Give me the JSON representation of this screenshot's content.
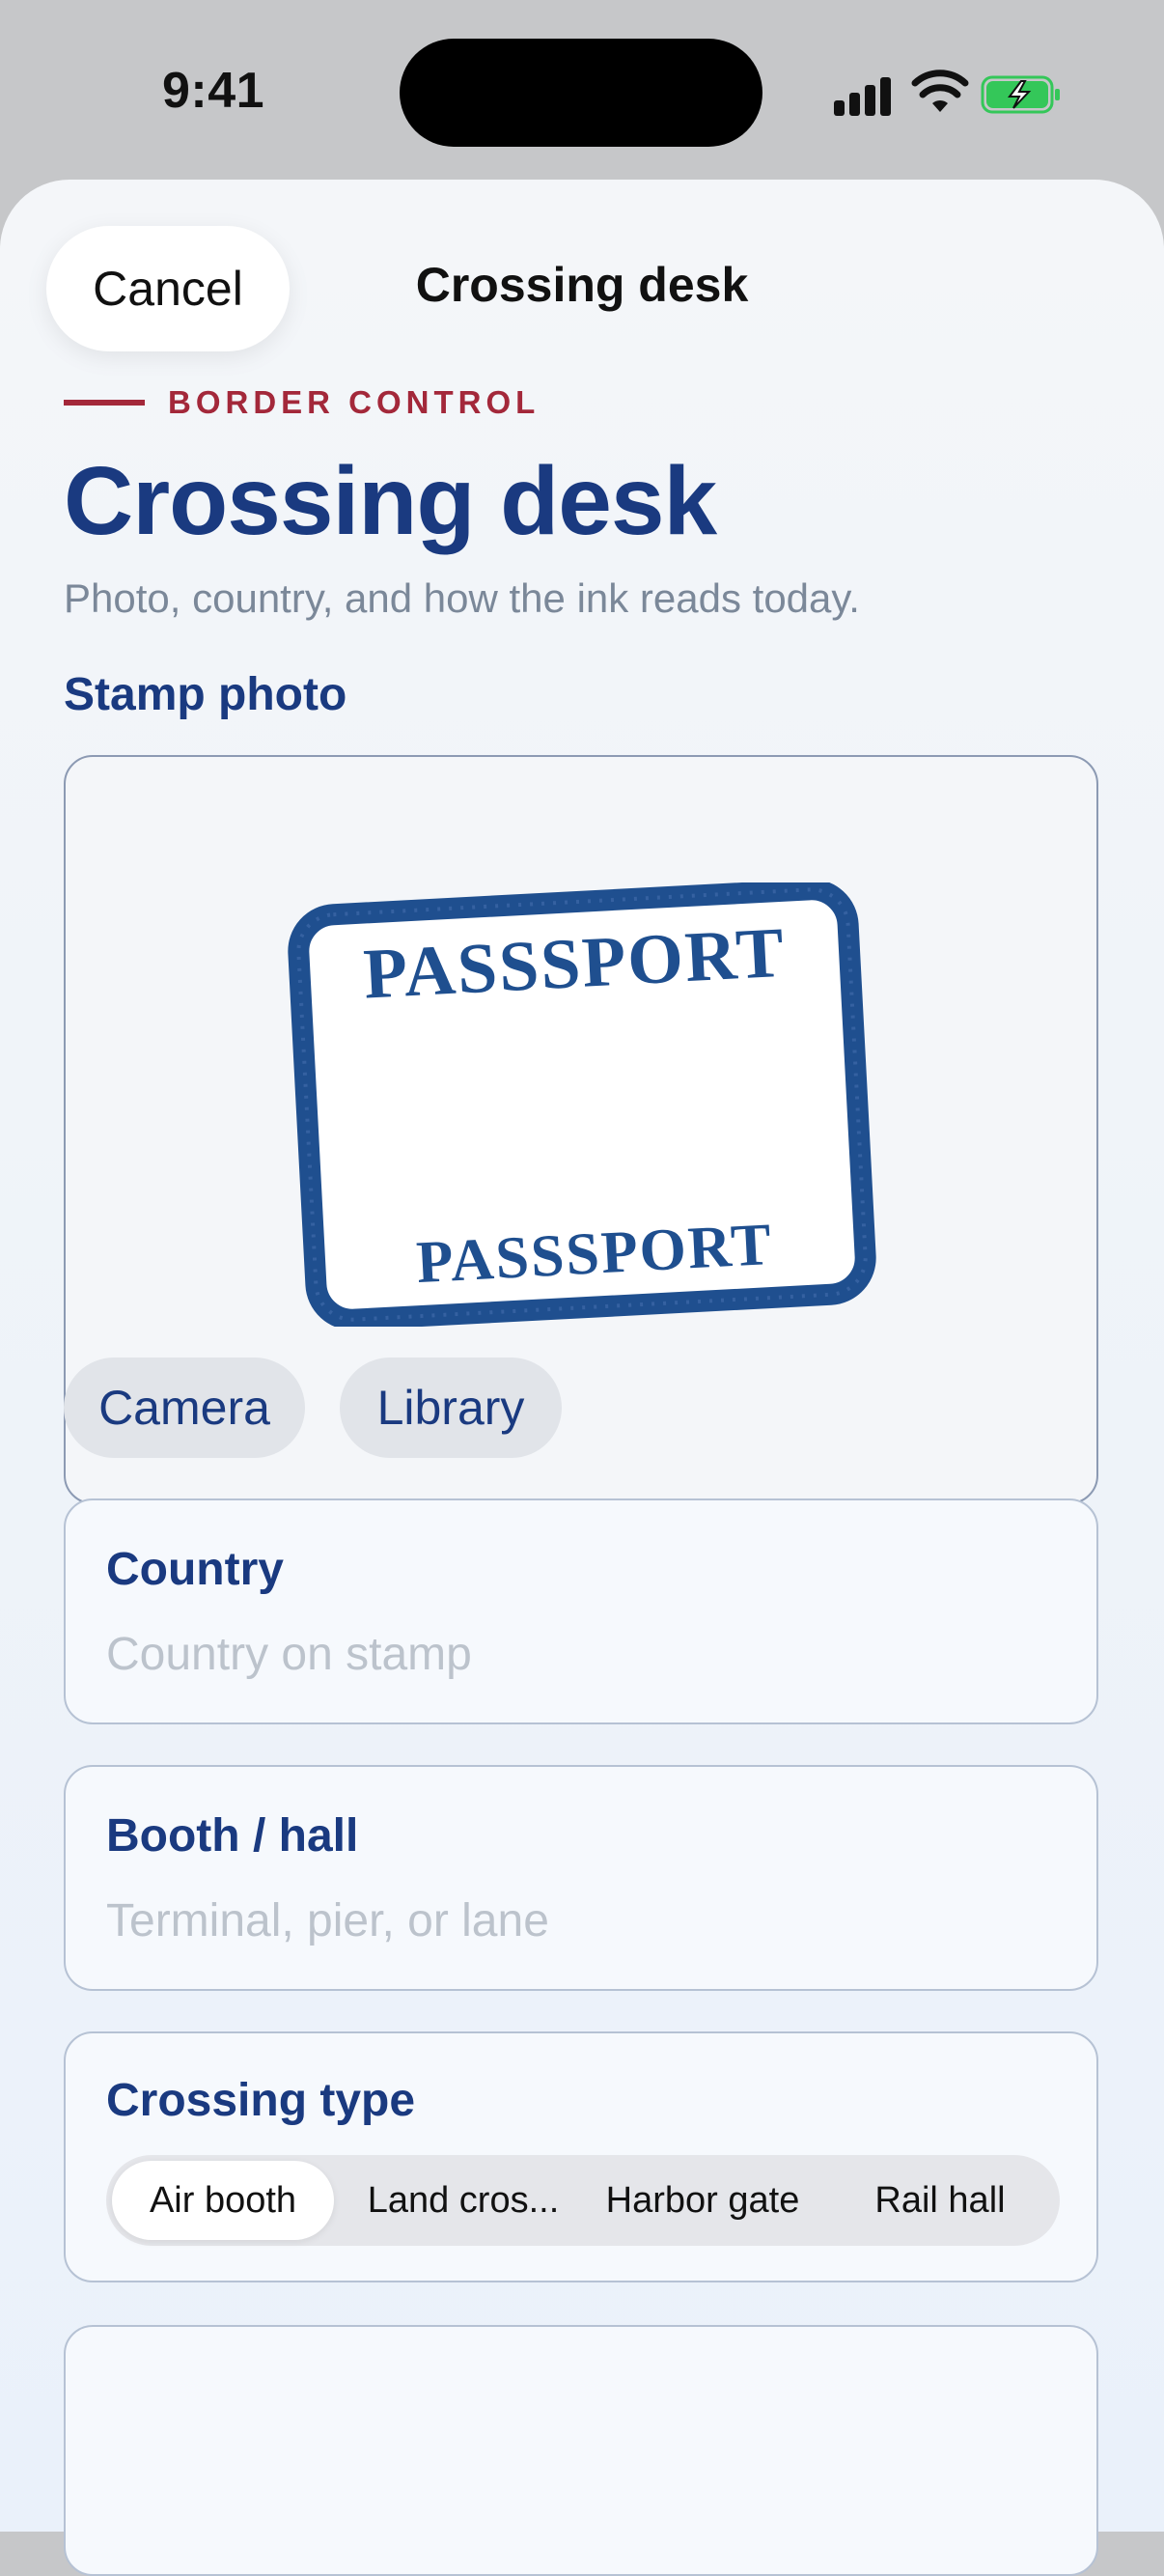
{
  "status_bar": {
    "time": "9:41",
    "icons": [
      "signal-icon",
      "wifi-icon",
      "battery-charging-icon"
    ]
  },
  "nav": {
    "cancel_label": "Cancel",
    "title": "Crossing desk"
  },
  "header": {
    "eyebrow": "BORDER CONTROL",
    "title": "Crossing desk",
    "subtitle": "Photo, country, and how the ink reads today."
  },
  "photo": {
    "section_label": "Stamp photo",
    "stamp_text_top": "PASSSPORT",
    "stamp_text_bottom": "PASSSPORT",
    "camera_label": "Camera",
    "library_label": "Library"
  },
  "fields": {
    "country": {
      "label": "Country",
      "placeholder": "Country on stamp"
    },
    "booth": {
      "label": "Booth / hall",
      "placeholder": "Terminal, pier, or lane"
    }
  },
  "crossing_type": {
    "label": "Crossing type",
    "options": [
      "Air booth",
      "Land cros...",
      "Harbor gate",
      "Rail hall"
    ],
    "selected": "Air booth"
  },
  "colors": {
    "accent_red": "#a3283a",
    "brand_navy": "#1a3a80",
    "stamp_ink": "#1f4f8f",
    "battery_green": "#34c759"
  }
}
